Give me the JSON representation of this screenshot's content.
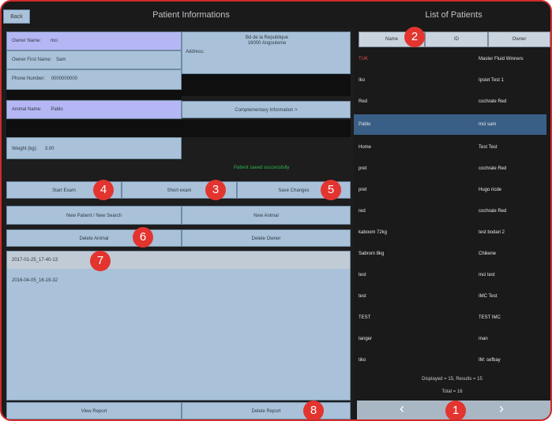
{
  "header": {
    "back_label": "Back",
    "left_title": "Patient Informations",
    "right_title": "List of Patients"
  },
  "owner": {
    "name_label": "Owner Name:",
    "name_value": "mci",
    "first_name_label": "Owner First Name:",
    "first_name_value": "Sam",
    "phone_label": "Phone Number:",
    "phone_value": "0000000000",
    "address_label": "Address:",
    "address_value_line1": "Bd de la Republique",
    "address_value_line2": "16000 Angouleme"
  },
  "animal": {
    "name_label": "Animal Name:",
    "name_value": "Pablo",
    "complementary_label": "Complementary Information >",
    "weight_label": "Weight (kg):",
    "weight_value": "3.00",
    "status_text": "Patient saved successfully"
  },
  "actions": {
    "start_exam": "Start Exam",
    "short_exam": "Short exam",
    "save_changes": "Save Changes",
    "new_patient": "New Patient / New Search",
    "new_animal": "New Animal",
    "delete_animal": "Delete Animal",
    "delete_owner": "Delete Owner",
    "view_report": "View Report",
    "delete_report": "Delete Report"
  },
  "history": [
    "2017-01-25_17-40-13",
    "2016-04-05_16-19-32"
  ],
  "patients": {
    "columns": [
      "Name",
      "ID",
      "Owner"
    ],
    "rows": [
      {
        "name": "TUK",
        "owner": "Master Fluid Winners"
      },
      {
        "name": "Iko",
        "owner": "Ipsiet Test 1"
      },
      {
        "name": "Red",
        "owner": "cochrale Red"
      },
      {
        "name": "Pablo",
        "owner": "mci sam"
      },
      {
        "name": "Home",
        "owner": "Test Test"
      },
      {
        "name": "pret",
        "owner": "cochrale Red"
      },
      {
        "name": "pret",
        "owner": "Hugo ricde"
      },
      {
        "name": "red",
        "owner": "cochrale Red"
      },
      {
        "name": "kaboom 72kg",
        "owner": "test bodari 2"
      },
      {
        "name": "Sabrom 8kg",
        "owner": "Chikene"
      },
      {
        "name": "test",
        "owner": "mci test"
      },
      {
        "name": "test",
        "owner": "IMC Test"
      },
      {
        "name": "TEST",
        "owner": "TEST IMC"
      },
      {
        "name": "tanger",
        "owner": "man"
      },
      {
        "name": "tiko",
        "owner": "IM: sefbay"
      }
    ],
    "summary_line1": "Displayed = 15, Results = 15",
    "summary_line2": "Total = 16"
  },
  "callouts": [
    "1",
    "2",
    "3",
    "4",
    "5",
    "6",
    "7",
    "8"
  ],
  "colors": {
    "frame": "#d02b2b",
    "panel": "#a9c2d9",
    "lavender": "#b5b7f5",
    "badge": "#e3342f",
    "selected_row": "#3a5f86",
    "status_green": "#2fb44d"
  }
}
